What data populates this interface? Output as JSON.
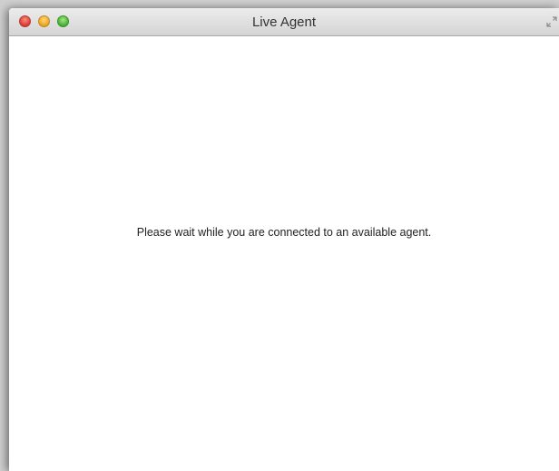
{
  "window": {
    "title": "Live Agent"
  },
  "controls": {
    "close_icon": "close-icon",
    "minimize_icon": "minimize-icon",
    "zoom_icon": "zoom-icon",
    "fullscreen_icon": "fullscreen-icon",
    "close_color": "#e0443a",
    "minimize_color": "#f0a92a",
    "zoom_color": "#4fb83b"
  },
  "content": {
    "message": "Please wait while you are connected to an available agent."
  }
}
